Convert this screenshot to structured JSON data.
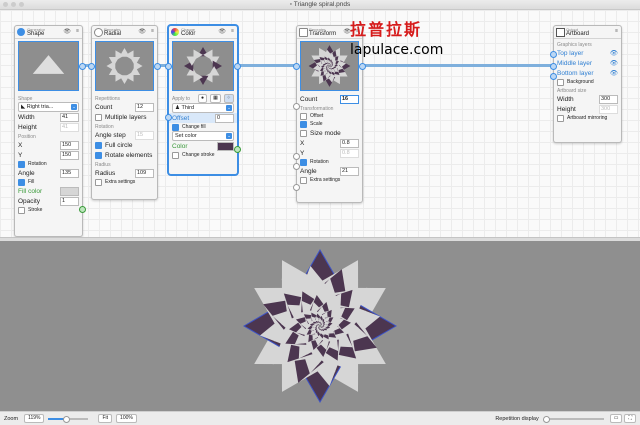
{
  "window": {
    "title": "Triangle spiral.pnds"
  },
  "watermark": {
    "chinese": "拉普拉斯",
    "site": "lapulace.com"
  },
  "nodes": {
    "shape": {
      "category": "Generator",
      "title": "Shape",
      "shape_section": "Shape",
      "shape_value": "Right tria...",
      "width_label": "Width",
      "width_value": "41",
      "height_label": "Height",
      "height_value": "41",
      "position_section": "Position",
      "x_label": "X",
      "x_value": "150",
      "y_label": "Y",
      "y_value": "150",
      "rotation_label": "Rotation",
      "angle_label": "Angle",
      "angle_value": "135",
      "fill_label": "Fill",
      "fill_color_label": "Fill color",
      "opacity_label": "Opacity",
      "opacity_value": "1",
      "stroke_label": "Stroke"
    },
    "radial": {
      "category": "Repeater",
      "title": "Radial",
      "repetitions_section": "Repetitions",
      "count_label": "Count",
      "count_value": "12",
      "multiple_layers_label": "Multiple layers",
      "rotation_section": "Rotation",
      "angle_step_label": "Angle step",
      "angle_step_value": "15",
      "full_circle_label": "Full circle",
      "rotate_elements_label": "Rotate elements",
      "radius_section": "Radius",
      "radius_label": "Radius",
      "radius_value": "109",
      "extra_settings_label": "Extra settings"
    },
    "color": {
      "category": "Change",
      "title": "Color",
      "apply_to_label": "Apply to",
      "apply_value": "Third",
      "offset_label": "Offset",
      "offset_value": "0",
      "change_fill_label": "Change fill",
      "set_color_value": "Set color",
      "color_label": "Color",
      "change_stroke_label": "Change stroke"
    },
    "transform": {
      "category": "Repeater",
      "title": "Transform",
      "count_label": "Count",
      "count_value": "16",
      "transformation_section": "Transformation",
      "offset_label": "Offset",
      "scale_label": "Scale",
      "size_mode_label": "Size mode",
      "x_label": "X",
      "x_value": "0.8",
      "y_label": "Y",
      "y_value": "0.8",
      "rotation_label": "Rotation",
      "angle_label": "Angle",
      "angle_value": "21",
      "extra_settings_label": "Extra settings"
    },
    "artboard": {
      "category": "Output",
      "title": "Artboard",
      "graphics_layers_section": "Graphics layers",
      "layers": [
        "Top layer",
        "Middle layer",
        "Bottom layer"
      ],
      "background_label": "Background",
      "artboard_size_section": "Artboard size",
      "width_label": "Width",
      "width_value": "300",
      "height_label": "Height",
      "height_value": "300",
      "mirroring_label": "Artboard mirroring"
    }
  },
  "statusbar": {
    "zoom_label": "Zoom",
    "zoom_value": "119%",
    "fit_label": "Fit",
    "hundred_label": "100%",
    "repetition_display_label": "Repetition display",
    "zoom_fraction": 0.45,
    "repetition_fraction": 0.03
  },
  "colors": {
    "accent": "#3d8ee4",
    "wire": "#7fb0dd",
    "shape_light": "#d6d6d6",
    "shape_dark": "#4c3650",
    "stroke_blue": "#3b52c8",
    "render_bg": "#8f8f8f"
  }
}
